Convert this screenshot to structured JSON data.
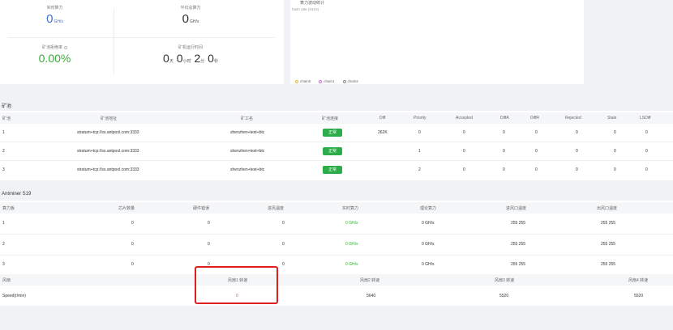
{
  "stats": {
    "realtime_label": "实时算力",
    "realtime_value": "0",
    "realtime_unit": "GH/s",
    "avg_label": "平均总算力",
    "avg_value": "0",
    "avg_unit": "GH/s",
    "reject_label": "矿池拒绝率",
    "reject_value": "0.00%",
    "runtime_label": "矿机运行时间",
    "runtime": {
      "days": "0",
      "days_unit": "天",
      "hours": "0",
      "hours_unit": "小时",
      "mins": "2",
      "mins_unit": "分",
      "secs": "0",
      "secs_unit": "秒"
    }
  },
  "chart": {
    "title": "算力波动统计",
    "subtitle": "hash rate (GH/s)",
    "legend": [
      {
        "name": "chain0",
        "color": "#e8b84a"
      },
      {
        "name": "chain1",
        "color": "#d86bd0"
      },
      {
        "name": "chain2",
        "color": "#888888"
      }
    ]
  },
  "pools": {
    "title": "矿池",
    "headers": [
      "矿池",
      "矿池地址",
      "矿工名",
      "矿池连接",
      "Diff",
      "Priority",
      "Accepted",
      "DiffA",
      "DiffR",
      "Rejected",
      "Stale",
      "LSDiff"
    ],
    "rows": [
      {
        "id": "1",
        "url": "stratum+tcp://ss.antpool.com:3333",
        "worker": "shenzhen+test+btc",
        "status": "正常",
        "diff": "262K",
        "priority": "0",
        "accepted": "0",
        "diffa": "0",
        "diffr": "0",
        "rejected": "0",
        "stale": "0",
        "lsdiff": "0"
      },
      {
        "id": "2",
        "url": "stratum+tcp://ss.antpool.com:3333",
        "worker": "shenzhen+test+btc",
        "status": "正常",
        "diff": "",
        "priority": "1",
        "accepted": "0",
        "diffa": "0",
        "diffr": "0",
        "rejected": "0",
        "stale": "0",
        "lsdiff": "0"
      },
      {
        "id": "3",
        "url": "stratum+tcp://ss.antpool.com:3333",
        "worker": "shenzhen+test+btc",
        "status": "正常",
        "diff": "",
        "priority": "2",
        "accepted": "0",
        "diffa": "0",
        "diffr": "0",
        "rejected": "0",
        "stale": "0",
        "lsdiff": "0"
      }
    ]
  },
  "miner": {
    "title": "Antminer S19",
    "headers": [
      "算力板",
      "芯片数量",
      "硬件错误",
      "进风温度",
      "实时算力",
      "理论算力",
      "进风口温度",
      "出风口温度"
    ],
    "rows": [
      {
        "board": "1",
        "chips": "0",
        "hw": "0",
        "temp": "0",
        "rt": "0",
        "rt_unit": "GH/s",
        "theo": "0",
        "theo_unit": "GH/s",
        "in": "255 255",
        "out": "255 255"
      },
      {
        "board": "2",
        "chips": "0",
        "hw": "0",
        "temp": "0",
        "rt": "0",
        "rt_unit": "GH/s",
        "theo": "0",
        "theo_unit": "GH/s",
        "in": "255 255",
        "out": "255 255"
      },
      {
        "board": "3",
        "chips": "0",
        "hw": "0",
        "temp": "0",
        "rt": "0",
        "rt_unit": "GH/s",
        "theo": "0",
        "theo_unit": "GH/s",
        "in": "255 255",
        "out": "255 255"
      }
    ],
    "fan": {
      "label": "风扇",
      "headers": [
        "风扇1 转速",
        "风扇2 转速",
        "风扇3 转速",
        "风扇4 转速"
      ],
      "speed_label": "Speed(r/min)",
      "speeds": [
        "0",
        "5640",
        "5520",
        "5520"
      ]
    }
  }
}
